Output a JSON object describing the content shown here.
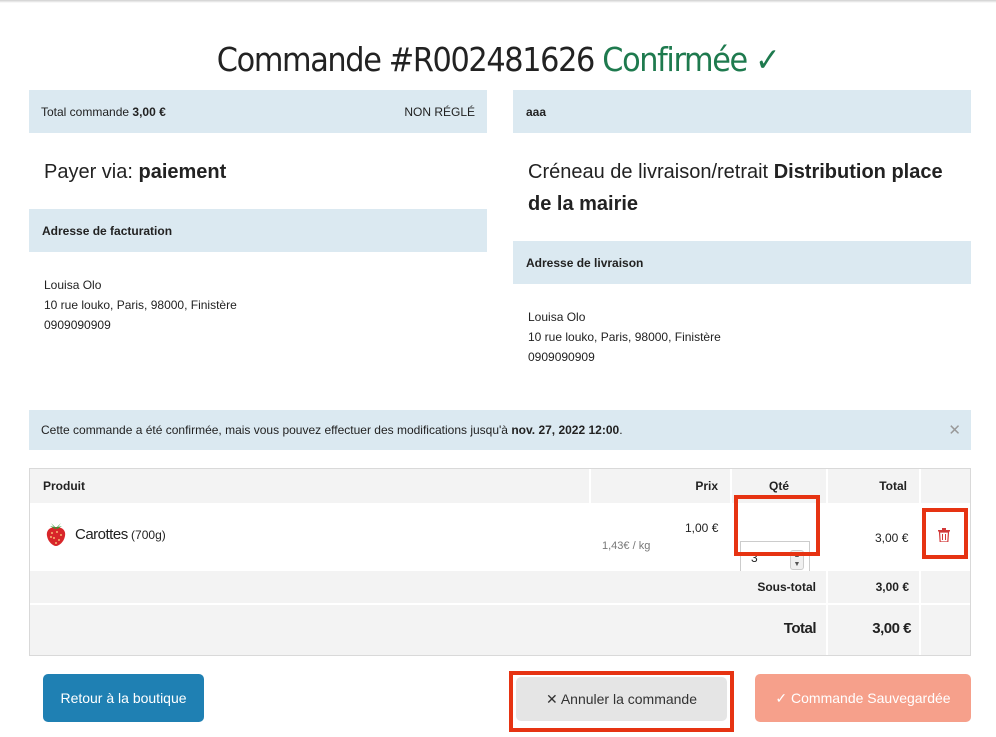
{
  "header": {
    "title_prefix": "Commande #R002481626",
    "status": "Confirmée ✓"
  },
  "summary": {
    "total_label": "Total commande",
    "total_value": "3,00 €",
    "payment_status": "NON RÉGLÉ",
    "right_label": "aaa"
  },
  "payment": {
    "label": "Payer via:",
    "method": "paiement"
  },
  "delivery": {
    "label": "Créneau de livraison/retrait",
    "slot": "Distribution place de la mairie"
  },
  "billing": {
    "heading": "Adresse de facturation",
    "name": "Louisa Olo",
    "street": "10 rue louko, Paris, 98000, Finistère",
    "phone": "0909090909"
  },
  "shipping": {
    "heading": "Adresse de livraison",
    "name": "Louisa Olo",
    "street": "10 rue louko, Paris, 98000, Finistère",
    "phone": "0909090909"
  },
  "notice": {
    "text": "Cette commande a été confirmée, mais vous pouvez effectuer des modifications jusqu'à",
    "deadline": "nov. 27, 2022 12:00",
    "end": ".",
    "close_icon": "close-icon"
  },
  "table": {
    "headers": {
      "product": "Produit",
      "price": "Prix",
      "qty": "Qté",
      "total": "Total"
    },
    "item": {
      "icon": "strawberry-icon",
      "name": "Carottes",
      "weight": "(700g)",
      "price": "1,00 €",
      "unit_price": "1,43€ / kg",
      "qty": "3",
      "total": "3,00 €",
      "delete_icon": "trash-icon"
    },
    "subtotal_label": "Sous-total",
    "subtotal_value": "3,00 €",
    "total_label": "Total",
    "total_value": "3,00 €"
  },
  "buttons": {
    "back": "Retour à la boutique",
    "cancel": "✕ Annuler la commande",
    "saved": "✓ Commande Sauvegardée"
  },
  "colors": {
    "accent_green": "#1e7a4e",
    "info_bar": "#dbe9f1",
    "primary_blue": "#1f80b3",
    "salmon": "#f6a08b",
    "highlight_red": "#e63312"
  }
}
